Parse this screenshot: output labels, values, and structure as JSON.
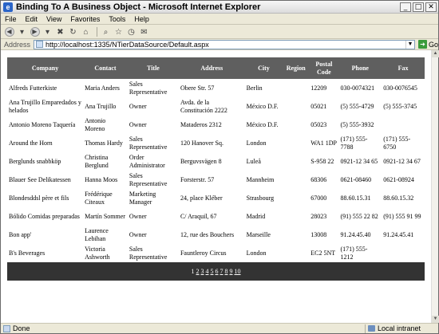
{
  "window": {
    "title": "Binding To A Business Object - Microsoft Internet Explorer"
  },
  "menu": [
    "File",
    "Edit",
    "View",
    "Favorites",
    "Tools",
    "Help"
  ],
  "address": {
    "label": "Address",
    "url": "http://localhost:1335/NTierDataSource/Default.aspx",
    "go_label": "Go"
  },
  "grid": {
    "columns": [
      "Company",
      "Contact",
      "Title",
      "Address",
      "City",
      "Region",
      "Postal Code",
      "Phone",
      "Fax"
    ],
    "rows": [
      [
        "Alfreds Futterkiste",
        "Maria Anders",
        "Sales Representative",
        "Obere Str. 57",
        "Berlin",
        "",
        "12209",
        "030-0074321",
        "030-0076545"
      ],
      [
        "Ana Trujillo Emparedados y helados",
        "Ana Trujillo",
        "Owner",
        "Avda. de la Constitución 2222",
        "México D.F.",
        "",
        "05021",
        "(5) 555-4729",
        "(5) 555-3745"
      ],
      [
        "Antonio Moreno Taquería",
        "Antonio Moreno",
        "Owner",
        "Mataderos 2312",
        "México D.F.",
        "",
        "05023",
        "(5) 555-3932",
        ""
      ],
      [
        "Around the Horn",
        "Thomas Hardy",
        "Sales Representative",
        "120 Hanover Sq.",
        "London",
        "",
        "WA1 1DP",
        "(171) 555-7788",
        "(171) 555-6750"
      ],
      [
        "Berglunds snabbköp",
        "Christina Berglund",
        "Order Administrator",
        "Berguvsvägen 8",
        "Luleå",
        "",
        "S-958 22",
        "0921-12 34 65",
        "0921-12 34 67"
      ],
      [
        "Blauer See Delikatessen",
        "Hanna Moos",
        "Sales Representative",
        "Forsterstr. 57",
        "Mannheim",
        "",
        "68306",
        "0621-08460",
        "0621-08924"
      ],
      [
        "Blondesddsl père et fils",
        "Frédérique Citeaux",
        "Marketing Manager",
        "24, place Kléber",
        "Strasbourg",
        "",
        "67000",
        "88.60.15.31",
        "88.60.15.32"
      ],
      [
        "Bólido Comidas preparadas",
        "Martín Sommer",
        "Owner",
        "C/ Araquil, 67",
        "Madrid",
        "",
        "28023",
        "(91) 555 22 82",
        "(91) 555 91 99"
      ],
      [
        "Bon app'",
        "Laurence Lebihan",
        "Owner",
        "12, rue des Bouchers",
        "Marseille",
        "",
        "13008",
        "91.24.45.40",
        "91.24.45.41"
      ],
      [
        "B's Beverages",
        "Victoria Ashworth",
        "Sales Representative",
        "Fauntleroy Circus",
        "London",
        "",
        "EC2 5NT",
        "(171) 555-1212",
        ""
      ]
    ],
    "pager": {
      "current": "1",
      "pages": [
        "2",
        "3",
        "4",
        "5",
        "6",
        "7",
        "8",
        "9",
        "10"
      ]
    }
  },
  "status": {
    "text": "Done",
    "zone": "Local intranet"
  }
}
